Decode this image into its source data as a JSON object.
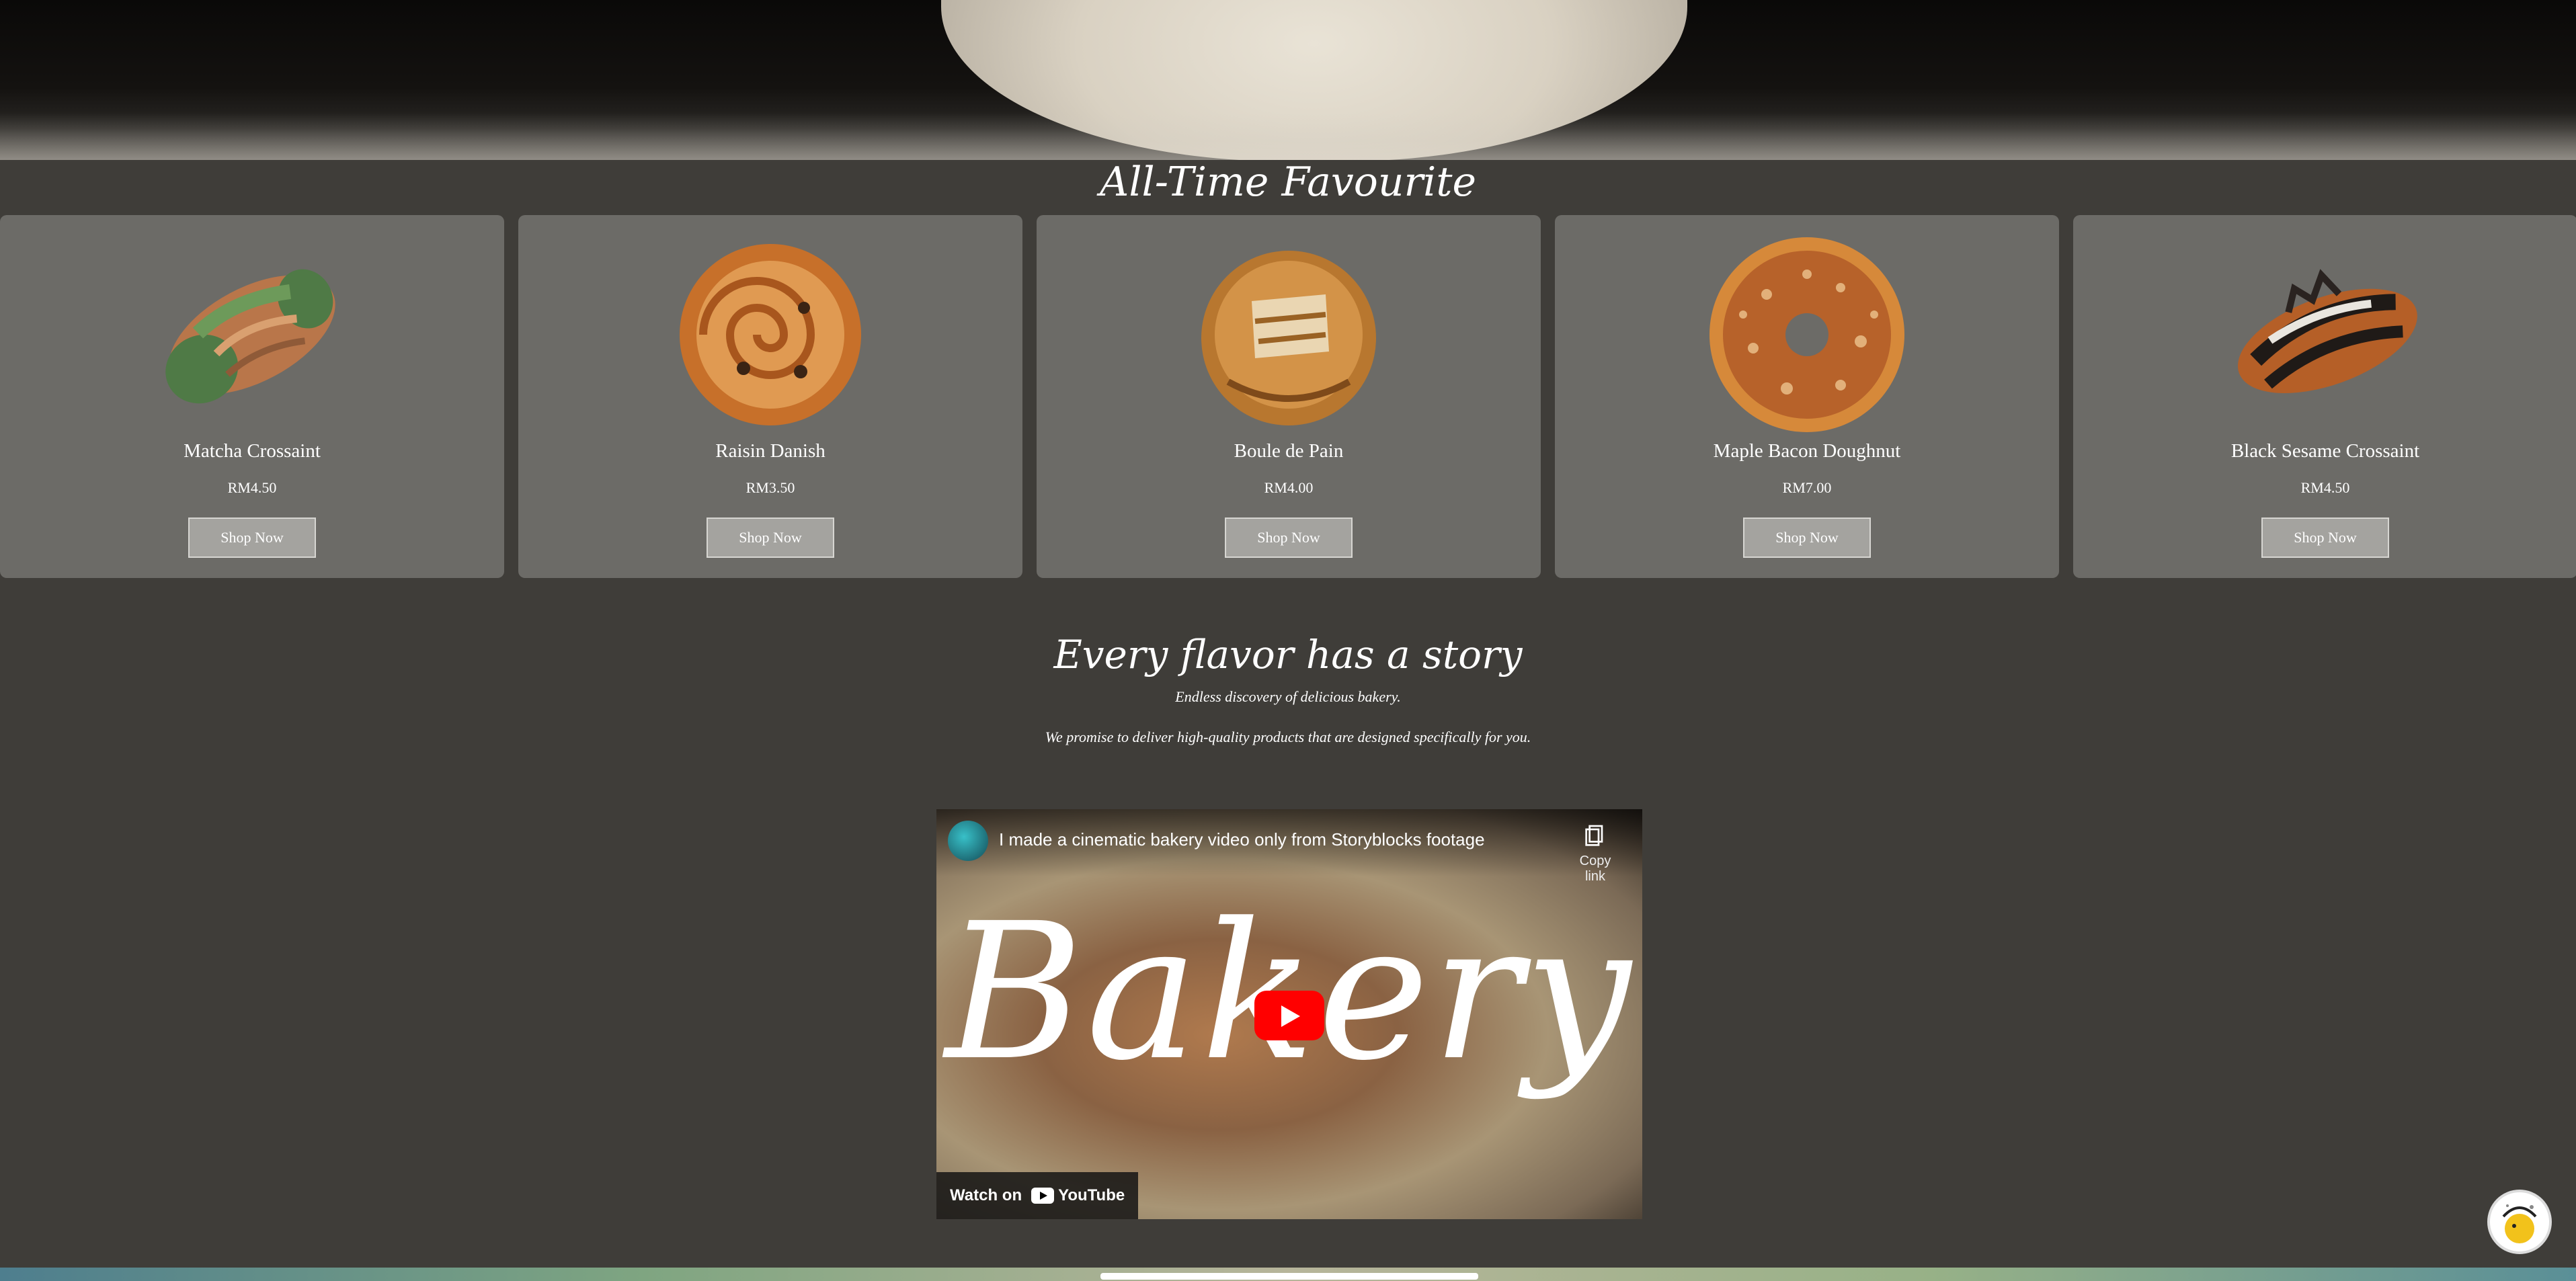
{
  "favourites": {
    "title": "All-Time Favourite",
    "products": [
      {
        "name": "Matcha Crossaint",
        "price": "RM4.50",
        "button": "Shop Now",
        "icon": "matcha-croissant-image"
      },
      {
        "name": "Raisin Danish",
        "price": "RM3.50",
        "button": "Shop Now",
        "icon": "raisin-danish-image"
      },
      {
        "name": "Boule de Pain",
        "price": "RM4.00",
        "button": "Shop Now",
        "icon": "boule-bread-image"
      },
      {
        "name": "Maple Bacon Doughnut",
        "price": "RM7.00",
        "button": "Shop Now",
        "icon": "doughnut-image"
      },
      {
        "name": "Black Sesame Crossaint",
        "price": "RM4.50",
        "button": "Shop Now",
        "icon": "black-sesame-croissant-image"
      }
    ]
  },
  "story": {
    "title": "Every flavor has a story",
    "line1": "Endless discovery of delicious bakery.",
    "line2": "We promise to deliver high-quality products that are designed specifically for you."
  },
  "video": {
    "title": "I made a cinematic bakery video only from Storyblocks footage",
    "copy_label": "Copy link",
    "overlay_word": "Bakery",
    "watch_on": "Watch on",
    "youtube_label": "YouTube"
  },
  "colors": {
    "background": "#3f3d39",
    "card": "#6c6b67",
    "button": "#a4a39f",
    "play": "#ff0000"
  }
}
